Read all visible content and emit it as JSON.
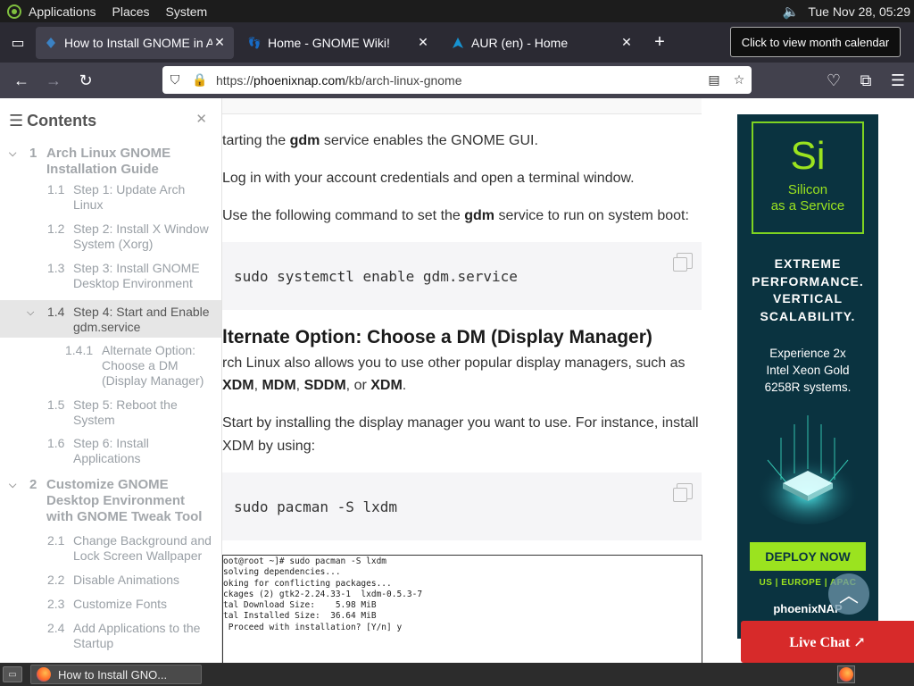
{
  "topbar": {
    "menus": [
      "Applications",
      "Places",
      "System"
    ],
    "clock": "Tue Nov 28, 05:29"
  },
  "tooltip": "Click to view month calendar",
  "tabs": [
    {
      "title": "How to Install GNOME in Ar",
      "active": true
    },
    {
      "title": "Home - GNOME Wiki!",
      "active": false
    },
    {
      "title": "AUR (en) - Home",
      "active": false
    }
  ],
  "url": {
    "prefix": "https://",
    "domain": "phoenixnap.com",
    "path": "/kb/arch-linux-gnome"
  },
  "toc": {
    "title": "Contents",
    "items": [
      {
        "num": "1",
        "text": "Arch Linux GNOME Installation Guide",
        "level": 1
      },
      {
        "num": "1.1",
        "text": "Step 1: Update Arch Linux",
        "level": 2
      },
      {
        "num": "1.2",
        "text": "Step 2: Install X Window System (Xorg)",
        "level": 2
      },
      {
        "num": "1.3",
        "text": "Step 3: Install GNOME Desktop Environment",
        "level": 2
      },
      {
        "num": "1.4",
        "text": "Step 4: Start and Enable gdm.service",
        "level": 2
      },
      {
        "num": "1.4.1",
        "text": "Alternate Option: Choose a DM (Display Manager)",
        "level": 3
      },
      {
        "num": "1.5",
        "text": "Step 5: Reboot the System",
        "level": 2
      },
      {
        "num": "1.6",
        "text": "Step 6: Install Applications",
        "level": 2
      },
      {
        "num": "2",
        "text": "Customize GNOME Desktop Environment with GNOME Tweak Tool",
        "level": 1
      },
      {
        "num": "2.1",
        "text": "Change Background and Lock Screen Wallpaper",
        "level": 2
      },
      {
        "num": "2.2",
        "text": "Disable Animations",
        "level": 2
      },
      {
        "num": "2.3",
        "text": "Customize Fonts",
        "level": 2
      },
      {
        "num": "2.4",
        "text": "Add Applications to the Startup",
        "level": 2
      }
    ]
  },
  "article": {
    "p1_pre": "tarting the ",
    "p1_bold": "gdm",
    "p1_post": " service enables the GNOME GUI.",
    "step1": " Log in with your account credentials and open a terminal window.",
    "step2_pre": " Use the following command to set the ",
    "step2_bold": "gdm",
    "step2_post": " service to run on system boot:",
    "code1": "sudo systemctl enable gdm.service",
    "heading": "lternate Option: Choose a DM (Display Manager)",
    "p2_line1": "rch Linux also allows you to use other popular display managers, such as",
    "p2_b1": "XDM",
    "p2_b2": "MDM",
    "p2_b3": "SDDM",
    "p2_or": ", or ",
    "p2_b4": "XDM",
    "step3_line1": " Start by installing the display manager you want to use. For instance, install",
    "step3_line2": "XDM by using:",
    "code2": "sudo pacman -S lxdm",
    "terminal": [
      "oot@root ~]# sudo pacman -S lxdm",
      "solving dependencies...",
      "oking for conflicting packages...",
      "",
      "ckages (2) gtk2-2.24.33-1  lxdm-0.5.3-7",
      "",
      "tal Download Size:    5.98 MiB",
      "tal Installed Size:  36.64 MiB",
      "",
      " Proceed with installation? [Y/n] y"
    ]
  },
  "ad": {
    "symbol": "Si",
    "subtitle_1": "Silicon",
    "subtitle_2": "as a Service",
    "headline": [
      "EXTREME",
      "PERFORMANCE.",
      "VERTICAL",
      "SCALABILITY."
    ],
    "body": [
      "Experience 2x",
      "Intel Xeon Gold",
      "6258R systems."
    ],
    "cta": "DEPLOY NOW",
    "regions": "US | EUROPE | APAC",
    "brand": "phoenixNAP"
  },
  "livechat": "Live Chat ↗",
  "taskbar": {
    "task": "How to Install GNO..."
  }
}
